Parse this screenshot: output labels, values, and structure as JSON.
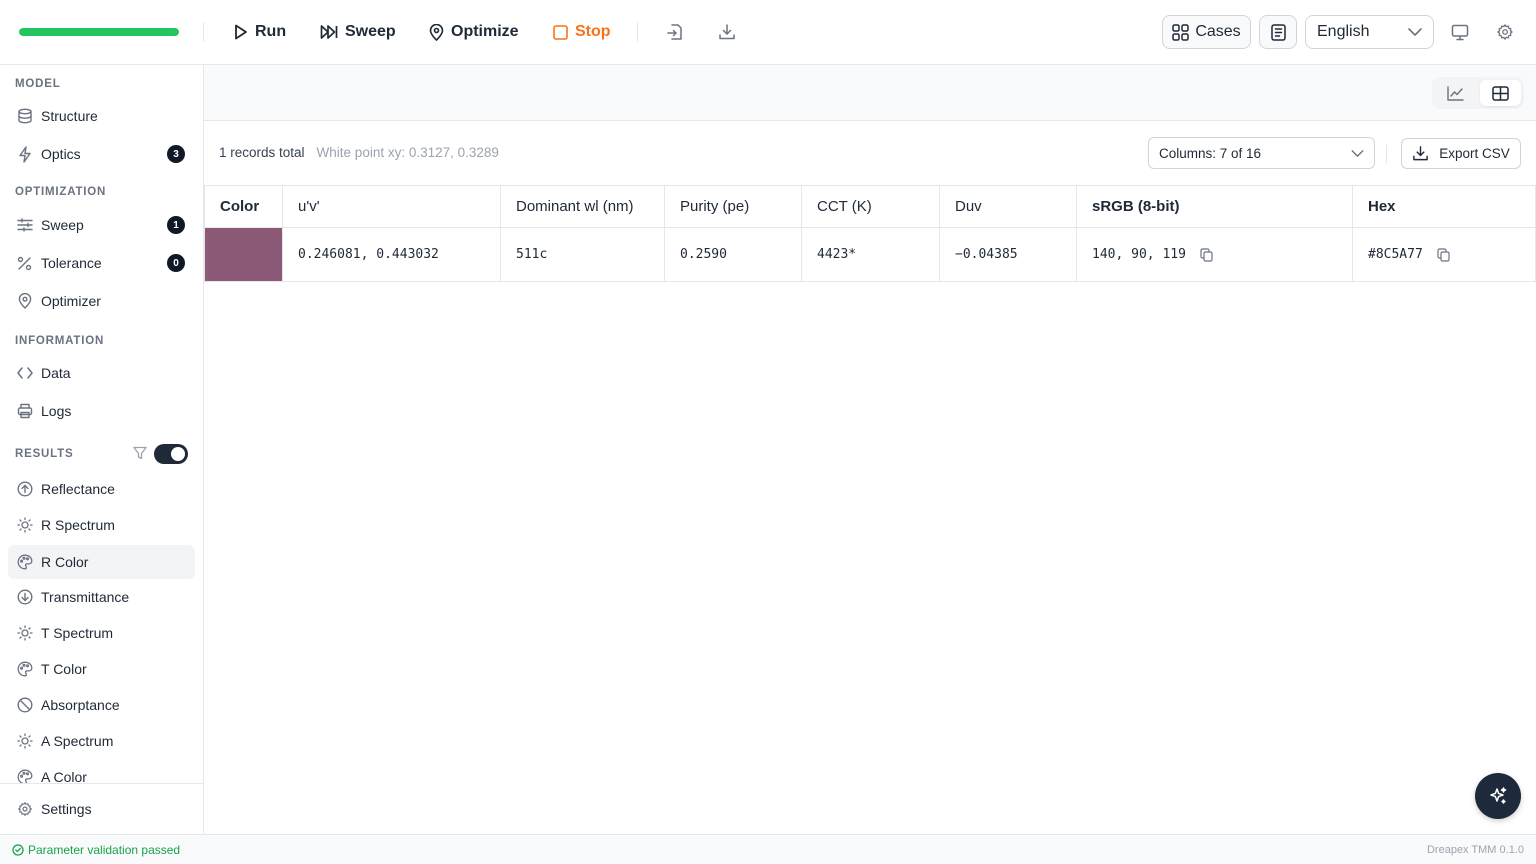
{
  "toolbar": {
    "progress_percent": 100,
    "run_label": "Run",
    "sweep_label": "Sweep",
    "optimize_label": "Optimize",
    "stop_label": "Stop",
    "cases_label": "Cases",
    "language": "English"
  },
  "sidebar": {
    "model_title": "MODEL",
    "model_items": [
      {
        "label": "Structure",
        "icon": "database-icon"
      },
      {
        "label": "Optics",
        "icon": "lightning-icon",
        "badge": "3"
      }
    ],
    "optimization_title": "OPTIMIZATION",
    "optimization_items": [
      {
        "label": "Sweep",
        "icon": "sliders-icon",
        "badge": "1"
      },
      {
        "label": "Tolerance",
        "icon": "percent-icon",
        "badge": "0"
      },
      {
        "label": "Optimizer",
        "icon": "location-pin-icon"
      }
    ],
    "information_title": "INFORMATION",
    "information_items": [
      {
        "label": "Data",
        "icon": "code-icon"
      },
      {
        "label": "Logs",
        "icon": "printer-icon"
      }
    ],
    "results_title": "RESULTS",
    "results_toggle_on": true,
    "results_items": [
      {
        "label": "Reflectance",
        "icon": "arrow-up-circle-icon"
      },
      {
        "label": "R Spectrum",
        "icon": "sun-icon"
      },
      {
        "label": "R Color",
        "icon": "palette-icon",
        "active": true
      },
      {
        "label": "Transmittance",
        "icon": "arrow-down-circle-icon"
      },
      {
        "label": "T Spectrum",
        "icon": "sun-icon"
      },
      {
        "label": "T Color",
        "icon": "palette-icon"
      },
      {
        "label": "Absorptance",
        "icon": "ban-icon"
      },
      {
        "label": "A Spectrum",
        "icon": "sun-icon"
      },
      {
        "label": "A Color",
        "icon": "palette-icon"
      }
    ],
    "settings_label": "Settings"
  },
  "main": {
    "records_total": "1 records total",
    "white_point": "White point xy: 0.3127, 0.3289",
    "columns_select": "Columns: 7 of 16",
    "export_label": "Export CSV",
    "table": {
      "headers": [
        "Color",
        "u'v'",
        "Dominant wl (nm)",
        "Purity (pe)",
        "CCT (K)",
        "Duv",
        "sRGB (8-bit)",
        "Hex"
      ],
      "rows": [
        {
          "color": "#8C5A77",
          "uv": "0.246081, 0.443032",
          "dominant_wl": "511c",
          "purity": "0.2590",
          "cct": "4423*",
          "duv": "−0.04385",
          "srgb": "140, 90, 119",
          "hex": "#8C5A77"
        }
      ]
    }
  },
  "statusbar": {
    "status_text": "Parameter validation passed",
    "version": "Dreapex TMM 0.1.0"
  },
  "colors": {
    "progress": "#22c55e",
    "stop": "#f97316",
    "status_ok": "#16a34a",
    "swatch": "#8C5A77"
  }
}
